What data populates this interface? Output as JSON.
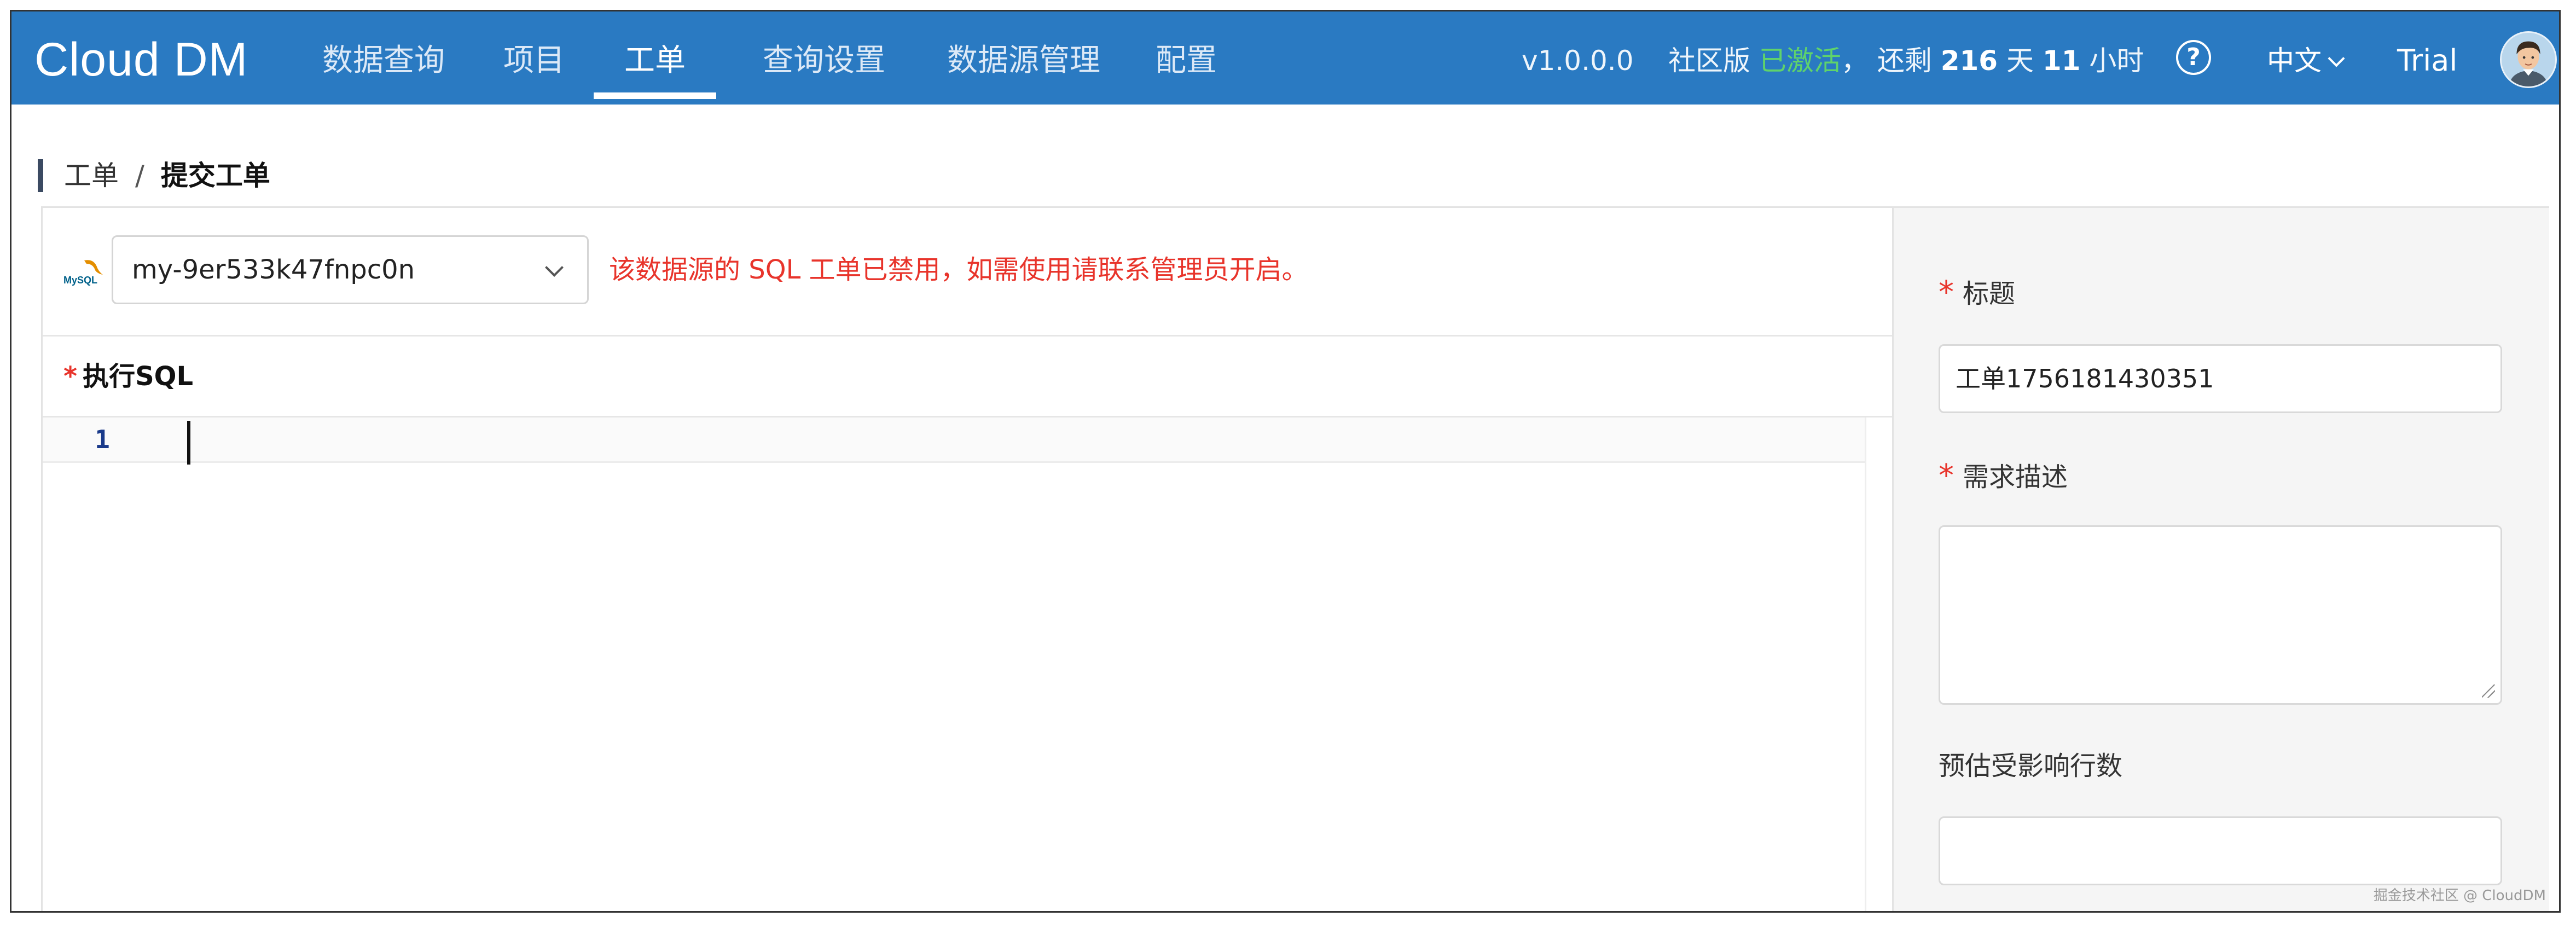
{
  "app": {
    "logo": "Cloud DM"
  },
  "nav": {
    "items": [
      {
        "label": "数据查询"
      },
      {
        "label": "项目"
      },
      {
        "label": "工单",
        "active": true
      },
      {
        "label": "查询设置"
      },
      {
        "label": "数据源管理"
      },
      {
        "label": "配置"
      }
    ]
  },
  "header": {
    "version": "v1.0.0.0",
    "edition": "社区版",
    "activated": "已激活",
    "comma": "，",
    "remaining_prefix": "还剩",
    "days": "216",
    "days_unit": "天",
    "hours": "11",
    "hours_unit": "小时",
    "language": "中文",
    "plan": "Trial",
    "help_glyph": "?"
  },
  "breadcrumb": {
    "parent": "工单",
    "separator": "/",
    "current": "提交工单"
  },
  "datasource": {
    "icon": "mysql-logo",
    "logo_text": "MySQL",
    "selected": "my-9er533k47fnpc0n",
    "warning": "该数据源的 SQL 工单已禁用，如需使用请联系管理员开启。"
  },
  "editor": {
    "required_mark": "*",
    "label": "执行SQL",
    "line_numbers": [
      "1"
    ]
  },
  "form": {
    "title_label": "标题",
    "title_value": "工单1756181430351",
    "desc_label": "需求描述",
    "desc_value": "",
    "rows_label": "预估受影响行数",
    "rows_value": "",
    "required_mark": "*"
  },
  "watermark": "掘金技术社区 @ CloudDM",
  "colors": {
    "header_bg": "#2a7ac2",
    "warning": "#e8342b",
    "activated": "#5fd36b"
  }
}
